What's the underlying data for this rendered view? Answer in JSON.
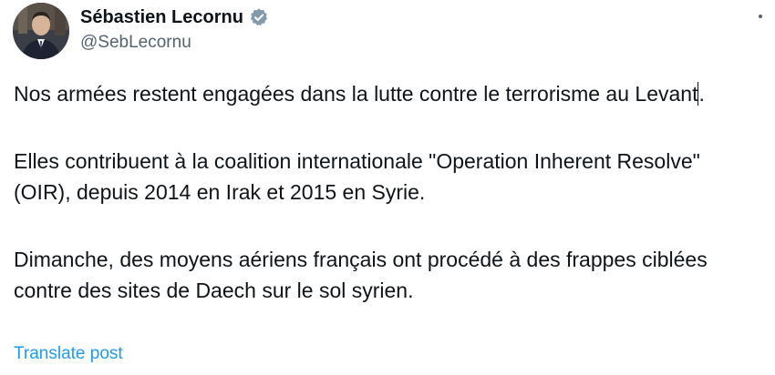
{
  "author": {
    "display_name": "Sébastien Lecornu",
    "handle": "@SebLecornu",
    "verified_icon": "verified-badge-icon",
    "verified_color": "#829aab"
  },
  "menu": {
    "icon": "more-options-icon"
  },
  "post": {
    "paragraph_1": {
      "before_caret": "Nos armées restent engagées dans la lutte contre le terrorisme au Levant",
      "after_caret": "."
    },
    "paragraph_2": "Elles contribuent à la coalition internationale \"Operation Inherent Resolve\" (OIR), depuis 2014 en Irak et 2015 en Syrie.",
    "paragraph_3": "Dimanche, des moyens aériens français ont procédé à des frappes ciblées contre des sites de Daech sur le sol syrien."
  },
  "translate_link": "Translate post",
  "colors": {
    "text": "#0f1419",
    "secondary": "#536471",
    "link": "#1d9bf0"
  }
}
